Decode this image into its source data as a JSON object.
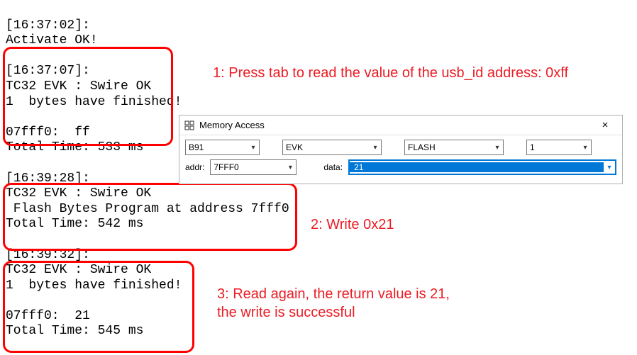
{
  "terminal": {
    "block0_l1": "[16:37:02]:",
    "block0_l2": "Activate OK!",
    "block1_l1": "[16:37:07]:",
    "block1_l2": "TC32 EVK : Swire OK",
    "block1_l3": "1  bytes have finished!",
    "block1_l4": "",
    "block1_l5": "07fff0:  ff",
    "block1_l6": "Total Time: 533 ms",
    "block2_l1": "[16:39:28]:",
    "block2_l2": "TC32 EVK : Swire OK",
    "block2_l3": " Flash Bytes Program at address 7fff0",
    "block2_l4": "Total Time: 542 ms",
    "block3_l1": "[16:39:32]:",
    "block3_l2": "TC32 EVK : Swire OK",
    "block3_l3": "1  bytes have finished!",
    "block3_l4": "",
    "block3_l5": "07fff0:  21",
    "block3_l6": "Total Time: 545 ms"
  },
  "annotations": {
    "a1": "1: Press tab to read the value of the usb_id address: 0xff",
    "a2": "2: Write 0x21",
    "a3_l1": "3: Read again, the return value is 21,",
    "a3_l2": "the write is successful"
  },
  "dialog": {
    "title": "Memory Access",
    "close": "×",
    "combo1": "B91",
    "combo2": "EVK",
    "combo3": "FLASH",
    "combo4": "1",
    "addr_label": "addr:",
    "addr_value": "7FFF0",
    "data_label": "data:",
    "data_value": "21"
  }
}
